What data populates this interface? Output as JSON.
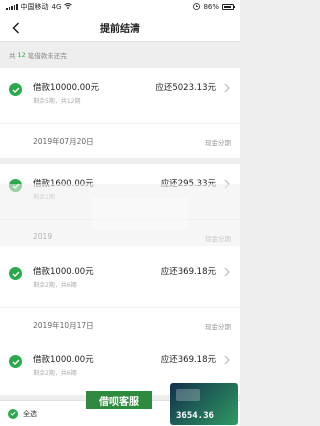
{
  "status": {
    "carrier": "中国移动",
    "network": "4G",
    "battery": "86%"
  },
  "nav": {
    "title": "提前结清"
  },
  "summary": {
    "prefix": "共",
    "count": "12",
    "suffix": "笔借款未还完"
  },
  "loans": [
    {
      "amount": "借款10000.00元",
      "periods": "剩余5期，共12期",
      "repay": "应还5023.13元",
      "date": "2019年07月20日",
      "type": "现金分期"
    },
    {
      "amount": "借款1600.00元",
      "periods": "剩余1期",
      "repay": "应还295.33元",
      "date": "2019",
      "type": "现金分期"
    },
    {
      "amount": "借款1000.00元",
      "periods": "剩余2期，共6期",
      "repay": "应还369.18元",
      "date": "2019年10月17日",
      "type": "现金分期"
    },
    {
      "amount": "借款1000.00元",
      "periods": "剩余2期，共6期",
      "repay": "应还369.18元"
    }
  ],
  "bottom": {
    "select_all": "全选"
  },
  "overlay": {
    "brand": "借呗客服",
    "logo_number": "3654.36"
  },
  "colors": {
    "accent": "#2baa4d",
    "background": "#eeeeee"
  }
}
